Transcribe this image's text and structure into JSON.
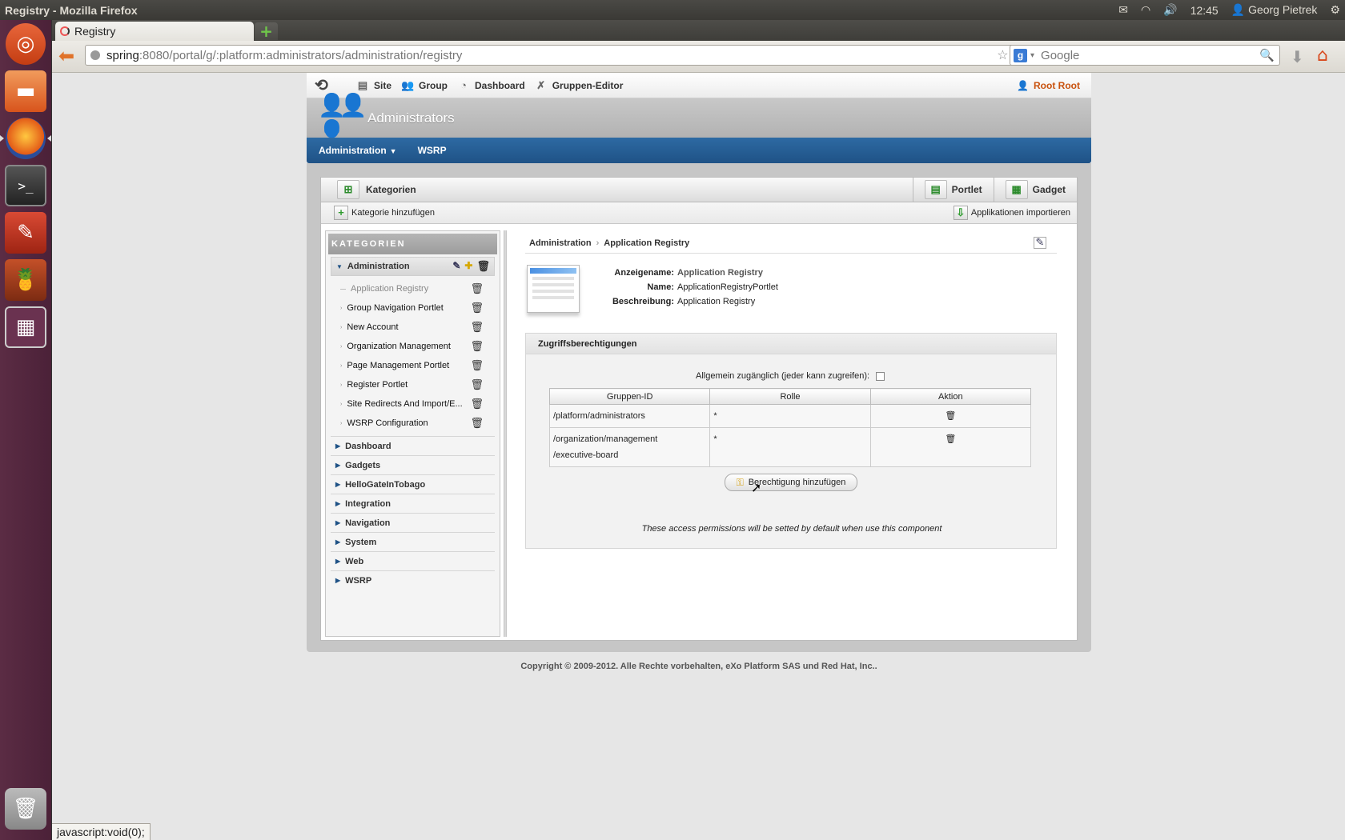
{
  "window": {
    "title": "Registry - Mozilla Firefox"
  },
  "tray": {
    "time": "12:45",
    "user": "Georg Pietrek"
  },
  "browser": {
    "tab_title": "Registry",
    "url_domain": "spring",
    "url_rest": ":8080/portal/g/:platform:administrators/administration/registry",
    "search_placeholder": "Google"
  },
  "portal": {
    "toolbar": {
      "items": [
        {
          "label": "Site"
        },
        {
          "label": "Group"
        },
        {
          "label": "Dashboard"
        },
        {
          "label": "Gruppen-Editor"
        }
      ],
      "user": "Root Root"
    },
    "header_title": "Administrators",
    "nav": {
      "administration": "Administration",
      "wsrp": "WSRP"
    },
    "tabs": {
      "categories": "Kategorien",
      "portlet": "Portlet",
      "gadget": "Gadget"
    },
    "actions": {
      "add_category": "Kategorie hinzufügen",
      "import_apps": "Applikationen importieren"
    },
    "sidebar": {
      "heading": "KATEGORIEN",
      "open_group": "Administration",
      "sub_items": [
        "Application Registry",
        "Group Navigation Portlet",
        "New Account",
        "Organization Management",
        "Page Management Portlet",
        "Register Portlet",
        "Site Redirects And Import/E...",
        "WSRP Configuration"
      ],
      "groups": [
        "Dashboard",
        "Gadgets",
        "HelloGateInTobago",
        "Integration",
        "Navigation",
        "System",
        "Web",
        "WSRP"
      ]
    },
    "detail": {
      "breadcrumb": [
        "Administration",
        "Application Registry"
      ],
      "display_name_label": "Anzeigename:",
      "display_name": "Application Registry",
      "name_label": "Name:",
      "name": "ApplicationRegistryPortlet",
      "description_label": "Beschreibung:",
      "description": "Application Registry",
      "permissions": {
        "title": "Zugriffsberechtigungen",
        "public_label": "Allgemein zugänglich (jeder kann zugreifen):",
        "columns": [
          "Gruppen-ID",
          "Rolle",
          "Aktion"
        ],
        "rows": [
          {
            "group": "/platform/administrators",
            "role": "*"
          },
          {
            "group": "/organization/management /executive-board",
            "role": "*"
          }
        ],
        "add_button": "Berechtigung hinzufügen",
        "note": "These access permissions will be setted by default when use this component"
      }
    },
    "copyright": "Copyright © 2009-2012. Alle Rechte vorbehalten, eXo Platform SAS und Red Hat, Inc.."
  },
  "statusbar": "javascript:void(0);"
}
